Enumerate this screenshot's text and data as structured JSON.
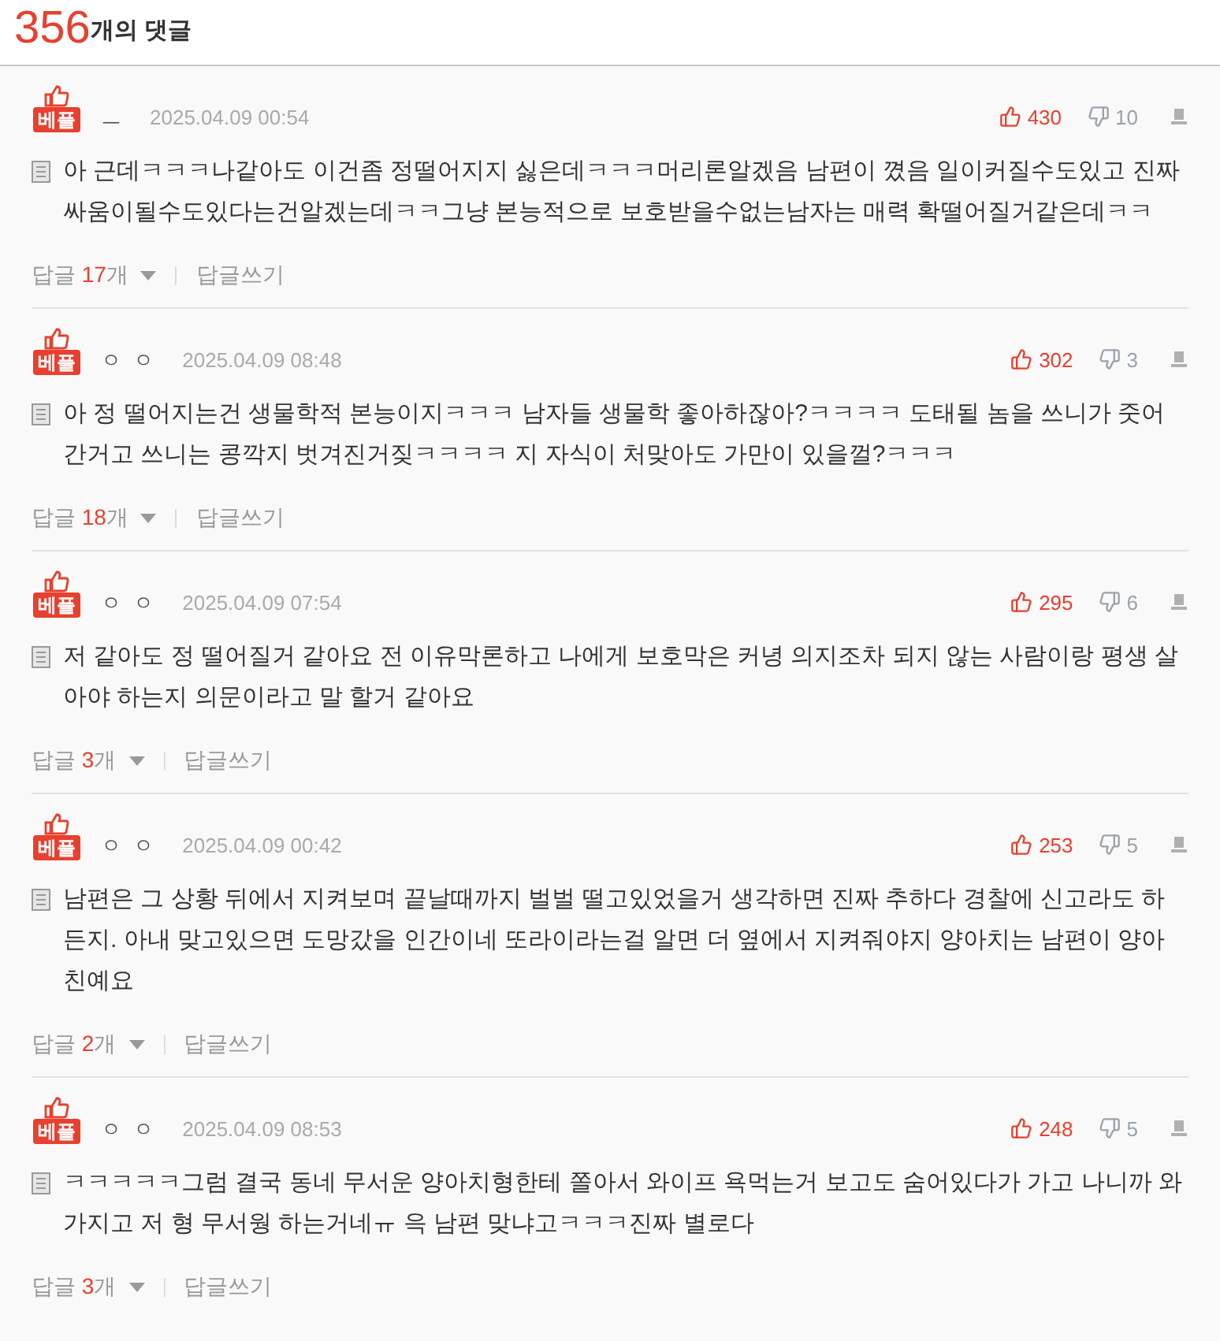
{
  "header": {
    "count": "356",
    "label": "개의 댓글"
  },
  "comments": [
    {
      "badge": "베플",
      "author": "ㅡ",
      "date": "2025.04.09 00:54",
      "likes": "430",
      "dislikes": "10",
      "text": "아 근데ㅋㅋㅋ나같아도 이건좀 정떨어지지 싫은데ㅋㅋㅋ머리론알겠음 남편이 꼈음 일이커질수도있고 진짜 싸움이될수도있다는건알겠는데ㅋㅋ그냥 본능적으로 보호받을수없는남자는 매력 확떨어질거같은데ㅋㅋ",
      "replies": "답글",
      "reply_count": "17",
      "reply_unit": "개",
      "write_reply": "답글쓰기"
    },
    {
      "badge": "베플",
      "author": "ㅇ ㅇ",
      "date": "2025.04.09 08:48",
      "likes": "302",
      "dislikes": "3",
      "text": "아 정 떨어지는건 생물학적 본능이지ㅋㅋㅋ 남자들 생물학 좋아하잖아?ㅋㅋㅋㅋ 도태될 놈을 쓰니가 줏어간거고 쓰니는 콩깍지 벗겨진거짖ㅋㅋㅋㅋ 지 자식이 처맞아도 가만이 있을껄?ㅋㅋㅋ",
      "replies": "답글",
      "reply_count": "18",
      "reply_unit": "개",
      "write_reply": "답글쓰기"
    },
    {
      "badge": "베플",
      "author": "ㅇ ㅇ",
      "date": "2025.04.09 07:54",
      "likes": "295",
      "dislikes": "6",
      "text": "저 같아도 정 떨어질거 같아요 전 이유막론하고 나에게 보호막은 커녕 의지조차 되지 않는 사람이랑 평생 살아야 하는지 의문이라고 말 할거 같아요",
      "replies": "답글",
      "reply_count": "3",
      "reply_unit": "개",
      "write_reply": "답글쓰기"
    },
    {
      "badge": "베플",
      "author": "ㅇ ㅇ",
      "date": "2025.04.09 00:42",
      "likes": "253",
      "dislikes": "5",
      "text": "남편은 그 상황 뒤에서 지켜보며 끝날때까지 벌벌 떨고있었을거 생각하면 진짜 추하다 경찰에 신고라도 하든지. 아내 맞고있으면 도망갔을 인간이네 또라이라는걸 알면 더 옆에서 지켜줘야지 양아치는 남편이 양아친예요",
      "replies": "답글",
      "reply_count": "2",
      "reply_unit": "개",
      "write_reply": "답글쓰기"
    },
    {
      "badge": "베플",
      "author": "ㅇ ㅇ",
      "date": "2025.04.09 08:53",
      "likes": "248",
      "dislikes": "5",
      "text": "ㅋㅋㅋㅋㅋ그럼 결국 동네 무서운 양아치형한테 쫄아서 와이프 욕먹는거 보고도 숨어있다가 가고 나니까 와가지고 저 형 무서웡 하는거네ㅠ 윽 남편 맞냐고ㅋㅋㅋ진짜 별로다",
      "replies": "답글",
      "reply_count": "3",
      "reply_unit": "개",
      "write_reply": "답글쓰기"
    }
  ]
}
